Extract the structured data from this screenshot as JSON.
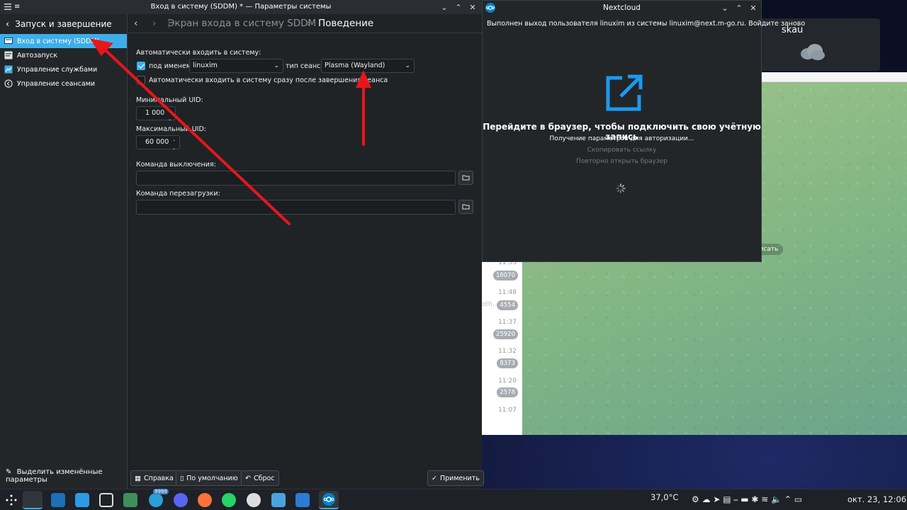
{
  "weather": {
    "city": "skau"
  },
  "telegram": {
    "times": [
      "11:53",
      "11:48",
      "11:37",
      "11:32",
      "11:20",
      "11:07"
    ],
    "badges": [
      "16070",
      "4554",
      "25920",
      "8373",
      "2578"
    ],
    "fragment": "oth...",
    "button": "исать"
  },
  "nextcloud": {
    "title": "Nextcloud",
    "message": "Выполнен выход пользователя linuxim из системы linuxim@next.m-go.ru. Войдите заново",
    "heading": "Перейдите в браузер, чтобы подключить свою учётную запись",
    "status": "Получение параметров для авторизации...",
    "copy_link": "Скопировать ссылку",
    "reopen": "Повторно открыть браузер"
  },
  "settings": {
    "window_title": "Вход в систему (SDDM) * — Параметры системы",
    "sidebar": {
      "header": "Запуск и завершение",
      "items": [
        {
          "label": "Вход в систему (SDDM)",
          "selected": true
        },
        {
          "label": "Автозапуск",
          "selected": false
        },
        {
          "label": "Управление службами",
          "selected": false
        },
        {
          "label": "Управление сеансами",
          "selected": false
        }
      ],
      "footer": "Выделить изменённые параметры"
    },
    "breadcrumb": {
      "parent": "Экран входа в систему SDDM",
      "current": "Поведение"
    },
    "autologin": {
      "label": "Автоматически входить в систему:",
      "user_label": "под именем:",
      "user_value": "linuxim",
      "session_label": "тип сеанса",
      "session_value": "Plasma (Wayland)",
      "relogin_label": "Автоматически входить в систему сразу после завершения сеанса",
      "user_checked": true,
      "relogin_checked": false
    },
    "min_uid": {
      "label": "Минимальный UID:",
      "value": "1 000"
    },
    "max_uid": {
      "label": "Максимальный UID:",
      "value": "60 000"
    },
    "halt": {
      "label": "Команда выключения:",
      "value": ""
    },
    "reboot": {
      "label": "Команда перезагрузки:",
      "value": ""
    },
    "buttons": {
      "help": "Справка",
      "defaults": "По умолчанию",
      "reset": "Сброс",
      "apply": "Применить"
    }
  },
  "taskbar": {
    "badge": "9999",
    "temp": "37,0°C",
    "datetime": "окт. 23, 12:06"
  },
  "colors": {
    "accent": "#3daee9",
    "arrow": "#e8161b",
    "nextcloud": "#0082c9"
  }
}
